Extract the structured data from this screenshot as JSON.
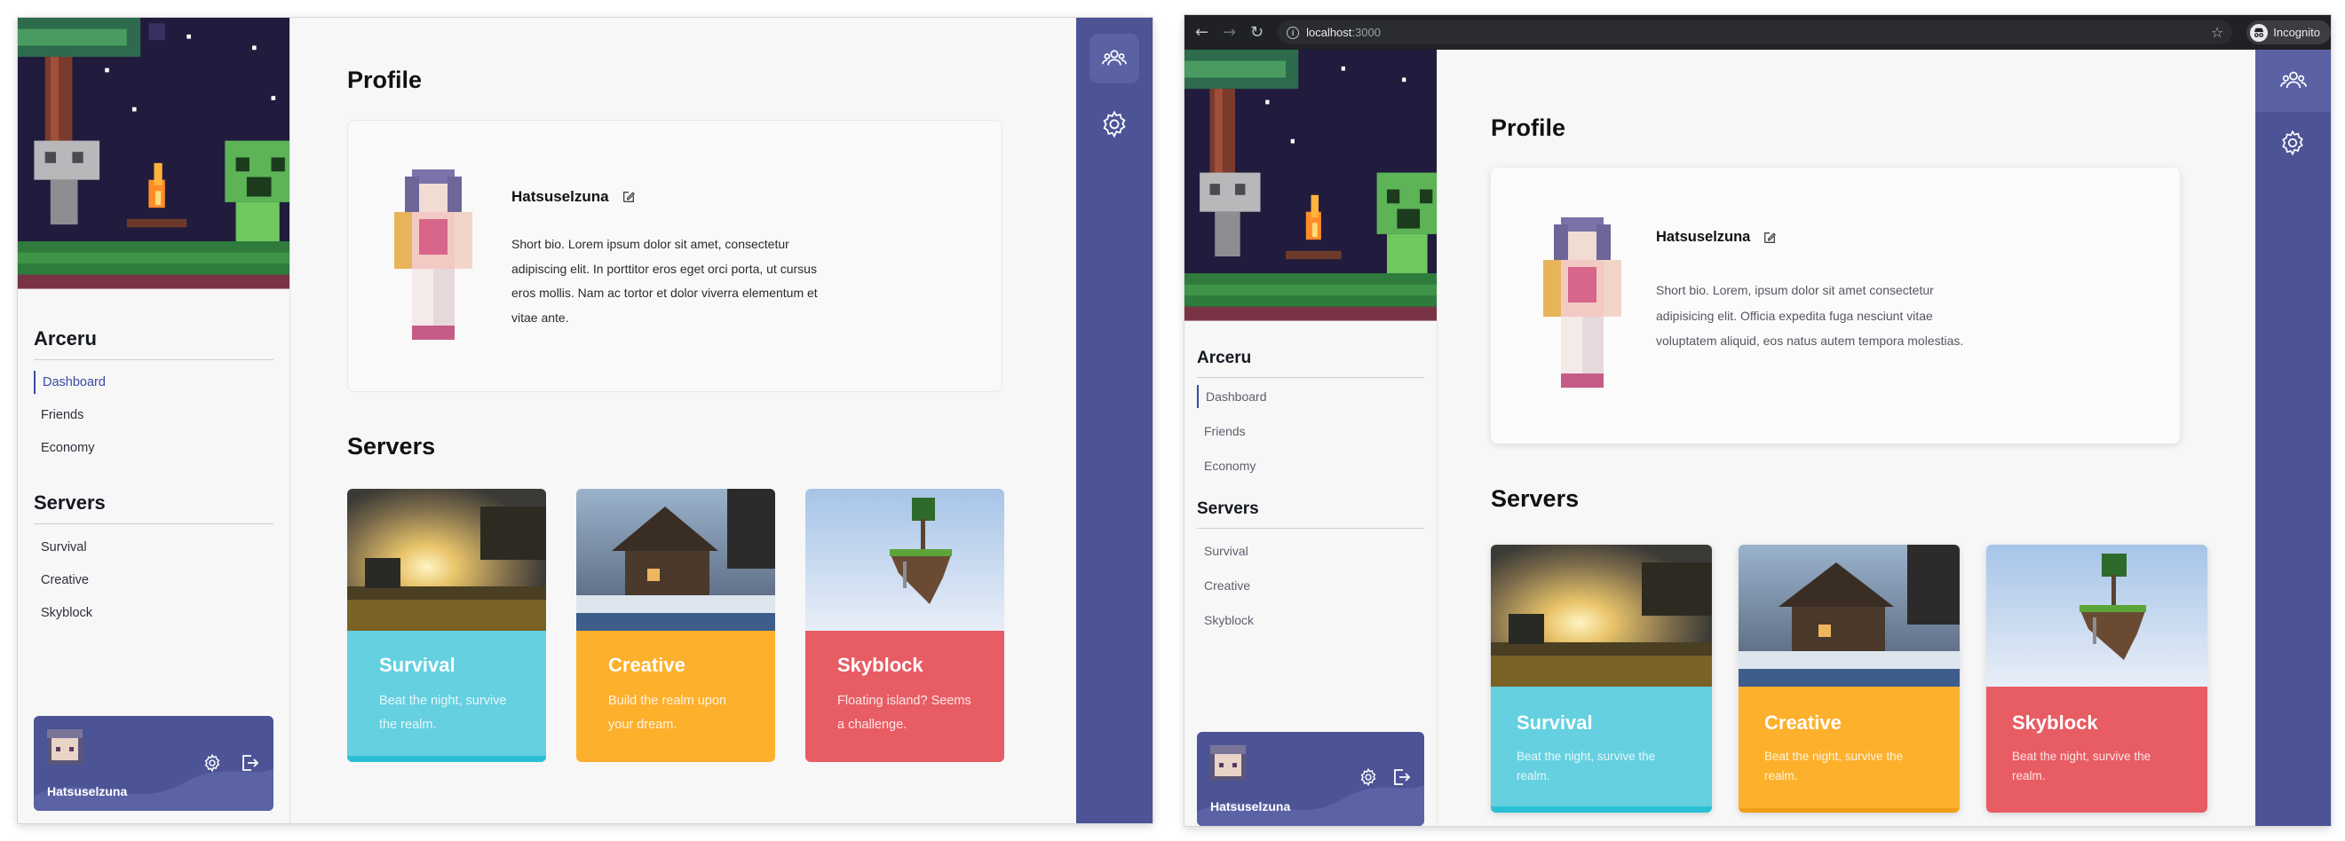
{
  "panels": [
    {
      "sidebar": {
        "group1_title": "Arceru",
        "group1_items": [
          "Dashboard",
          "Friends",
          "Economy"
        ],
        "group2_title": "Servers",
        "group2_items": [
          "Survival",
          "Creative",
          "Skyblock"
        ]
      },
      "user": {
        "name": "Hatsuselzuna"
      },
      "profile": {
        "title": "Profile",
        "name": "Hatsuselzuna",
        "bio": "Short bio. Lorem ipsum dolor sit amet, consectetur adipiscing elit. In porttitor eros eget orci porta, ut cursus eros mollis. Nam ac tortor et dolor viverra elementum et vitae ante."
      },
      "servers": {
        "title": "Servers",
        "cards": [
          {
            "name": "Survival",
            "desc": "Beat the night, survive the realm.",
            "color": "#64d0e0"
          },
          {
            "name": "Creative",
            "desc": "Build the realm upon your dream.",
            "color": "#fcb02c"
          },
          {
            "name": "Skyblock",
            "desc": "Floating island? Seems a challenge.",
            "color": "#e85c64"
          }
        ]
      }
    },
    {
      "browser": {
        "url_host": "localhost",
        "url_port": ":3000",
        "mode_label": "Incognito"
      },
      "sidebar": {
        "group1_title": "Arceru",
        "group1_items": [
          "Dashboard",
          "Friends",
          "Economy"
        ],
        "group2_title": "Servers",
        "group2_items": [
          "Survival",
          "Creative",
          "Skyblock"
        ]
      },
      "user": {
        "name": "Hatsuselzuna"
      },
      "profile": {
        "title": "Profile",
        "name": "Hatsuselzuna",
        "bio": "Short bio. Lorem, ipsum dolor sit amet consectetur adipisicing elit. Officia expedita fuga nesciunt vitae voluptatem aliquid, eos natus autem tempora molestias."
      },
      "servers": {
        "title": "Servers",
        "cards": [
          {
            "name": "Survival",
            "desc": "Beat the night, survive the realm.",
            "color": "#64d0e0"
          },
          {
            "name": "Creative",
            "desc": "Beat the night, survive the realm.",
            "color": "#fcb02c"
          },
          {
            "name": "Skyblock",
            "desc": "Beat the night, survive the realm.",
            "color": "#e85c64"
          }
        ]
      }
    }
  ],
  "colors": {
    "accent": "#4c5496",
    "active_nav": "#3b4aa0"
  },
  "icons": [
    "users-icon",
    "gear-icon",
    "edit-icon",
    "logout-icon",
    "back-icon",
    "forward-icon",
    "reload-icon",
    "info-icon",
    "star-icon",
    "incognito-icon"
  ]
}
